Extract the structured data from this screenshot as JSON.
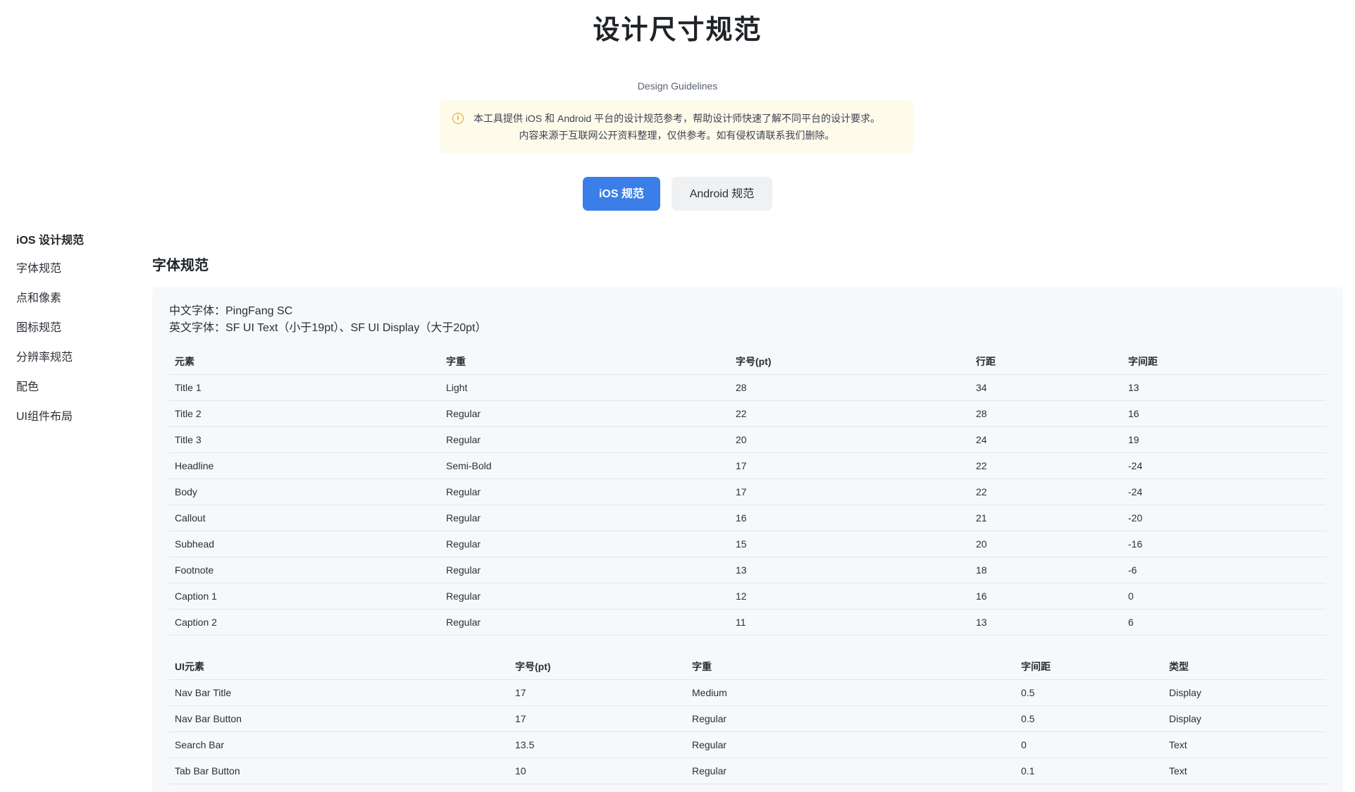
{
  "header": {
    "title": "设计尺寸规范",
    "subtitle": "Design Guidelines"
  },
  "notice": {
    "icon": "info-icon",
    "line1": "本工具提供 iOS 和 Android 平台的设计规范参考，帮助设计师快速了解不同平台的设计要求。",
    "line2": "内容来源于互联网公开资料整理，仅供参考。如有侵权请联系我们删除。"
  },
  "platforms": {
    "ios_label": "iOS 规范",
    "android_label": "Android 规范",
    "active": "ios",
    "active_color": "#3b7ee8"
  },
  "sidebar": {
    "items": [
      {
        "label": "iOS 设计规范"
      },
      {
        "label": "字体规范"
      },
      {
        "label": "点和像素"
      },
      {
        "label": "图标规范"
      },
      {
        "label": "分辨率规范"
      },
      {
        "label": "配色"
      },
      {
        "label": "UI组件布局"
      }
    ]
  },
  "section": {
    "title": "字体规范",
    "chinese_font": "中文字体：PingFang SC",
    "english_font": "英文字体：SF UI Text（小于19pt）、SF UI Display（大于20pt）"
  },
  "font_table": {
    "headers": [
      "元素",
      "字重",
      "字号(pt)",
      "行距",
      "字间距"
    ],
    "rows": [
      [
        "Title 1",
        "Light",
        "28",
        "34",
        "13"
      ],
      [
        "Title 2",
        "Regular",
        "22",
        "28",
        "16"
      ],
      [
        "Title 3",
        "Regular",
        "20",
        "24",
        "19"
      ],
      [
        "Headline",
        "Semi-Bold",
        "17",
        "22",
        "-24"
      ],
      [
        "Body",
        "Regular",
        "17",
        "22",
        "-24"
      ],
      [
        "Callout",
        "Regular",
        "16",
        "21",
        "-20"
      ],
      [
        "Subhead",
        "Regular",
        "15",
        "20",
        "-16"
      ],
      [
        "Footnote",
        "Regular",
        "13",
        "18",
        "-6"
      ],
      [
        "Caption 1",
        "Regular",
        "12",
        "16",
        "0"
      ],
      [
        "Caption 2",
        "Regular",
        "11",
        "13",
        "6"
      ]
    ]
  },
  "ui_table": {
    "headers": [
      "UI元素",
      "字号(pt)",
      "字重",
      "字间距",
      "类型"
    ],
    "rows": [
      [
        "Nav Bar Title",
        "17",
        "Medium",
        "0.5",
        "Display"
      ],
      [
        "Nav Bar Button",
        "17",
        "Regular",
        "0.5",
        "Display"
      ],
      [
        "Search Bar",
        "13.5",
        "Regular",
        "0",
        "Text"
      ],
      [
        "Tab Bar Button",
        "10",
        "Regular",
        "0.1",
        "Text"
      ]
    ]
  }
}
